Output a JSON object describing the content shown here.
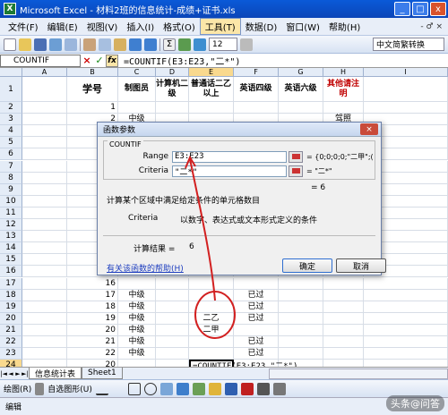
{
  "window": {
    "title": "Microsoft Excel - 材料2班的信息统计-成绩+证书.xls",
    "logo": "X",
    "minimize": "_",
    "maximize": "□",
    "close": "x"
  },
  "menubar": {
    "items": [
      "文件(F)",
      "编辑(E)",
      "视图(V)",
      "插入(I)",
      "格式(O)",
      "工具(T)",
      "数据(D)",
      "窗口(W)",
      "帮助(H)"
    ],
    "active_index": 5,
    "right_text": "- ♂ ×"
  },
  "toolbar": {
    "font_size": "12",
    "input_method": "中文简繁转换"
  },
  "formula_bar": {
    "name_box": "COUNTIF",
    "cancel": "×",
    "enter": "✓",
    "fx": "fx",
    "formula": "=COUNTIF(E3:E23,\"二*\")"
  },
  "columns": [
    "A",
    "B",
    "C",
    "D",
    "E",
    "F",
    "G",
    "H",
    "I"
  ],
  "selected_column": "E",
  "header_row": {
    "B": "学号",
    "C": "制图员",
    "D": "计算机二级",
    "E": "普通话二乙以上",
    "F": "英语四级",
    "G": "英语六级",
    "H": "其他请注明"
  },
  "rows": [
    {
      "n": "1"
    },
    {
      "n": "2",
      "B": "1"
    },
    {
      "n": "3",
      "B": "2",
      "C": "中级",
      "H": "驾照"
    },
    {
      "n": "4",
      "B": "3"
    },
    {
      "n": "5",
      "B": "4"
    },
    {
      "n": "6",
      "B": "5"
    },
    {
      "n": "7",
      "B": "6"
    },
    {
      "n": "8",
      "B": "7"
    },
    {
      "n": "9",
      "B": "8"
    },
    {
      "n": "10",
      "B": "9"
    },
    {
      "n": "11",
      "B": "10"
    },
    {
      "n": "12",
      "B": "11"
    },
    {
      "n": "13",
      "B": "12"
    },
    {
      "n": "14",
      "B": "13"
    },
    {
      "n": "15",
      "B": "14"
    },
    {
      "n": "16",
      "B": "15"
    },
    {
      "n": "17",
      "B": "16"
    },
    {
      "n": "18",
      "B": "17",
      "C": "中级",
      "F": "已过"
    },
    {
      "n": "19",
      "B": "18",
      "C": "中级",
      "F": "已过"
    },
    {
      "n": "20",
      "B": "19",
      "C": "中级",
      "E": "二乙",
      "F": "已过"
    },
    {
      "n": "21",
      "B": "20",
      "C": "中级",
      "E": "二甲"
    },
    {
      "n": "22",
      "B": "21",
      "C": "中级",
      "F": "已过"
    },
    {
      "n": "23",
      "B": "22",
      "C": "中级",
      "F": "已过"
    },
    {
      "n": "24",
      "B": "20",
      "E": "=COUNTIF(E3:E23,\"二*\")"
    }
  ],
  "dialog": {
    "title": "函数参数",
    "close": "×",
    "function_name": "COUNTIF",
    "range_label": "Range",
    "range_value": "E3:E23",
    "range_result": "= {0;0;0;0;\"二甲\";(",
    "criteria_label": "Criteria",
    "criteria_value": "\"二*\"",
    "criteria_result": "= \"二*\"",
    "total_result": "= 6",
    "description": "计算某个区域中满足给定条件的单元格数目",
    "param_name": "Criteria",
    "param_desc": "以数字、表达式或文本形式定义的条件",
    "calc_label": "计算结果 =",
    "calc_value": "6",
    "help_link": "有关该函数的帮助(H)",
    "ok": "确定",
    "cancel": "取消"
  },
  "sheet_tabs": {
    "nav": [
      "|◄",
      "◄",
      "►",
      "►|"
    ],
    "tabs": [
      "信息统计表",
      "Sheet1"
    ],
    "active_index": 0
  },
  "drawbar": {
    "draw_label": "绘图(R)",
    "autoshape_label": "自选图形(U)"
  },
  "status": {
    "mode": "编辑"
  },
  "watermark": "头条@问答",
  "colors": {
    "title_bar": "#0b46b8",
    "selected_header": "#f9d98e",
    "annotation_red": "#d22020",
    "link_blue": "#1f3fbf"
  }
}
